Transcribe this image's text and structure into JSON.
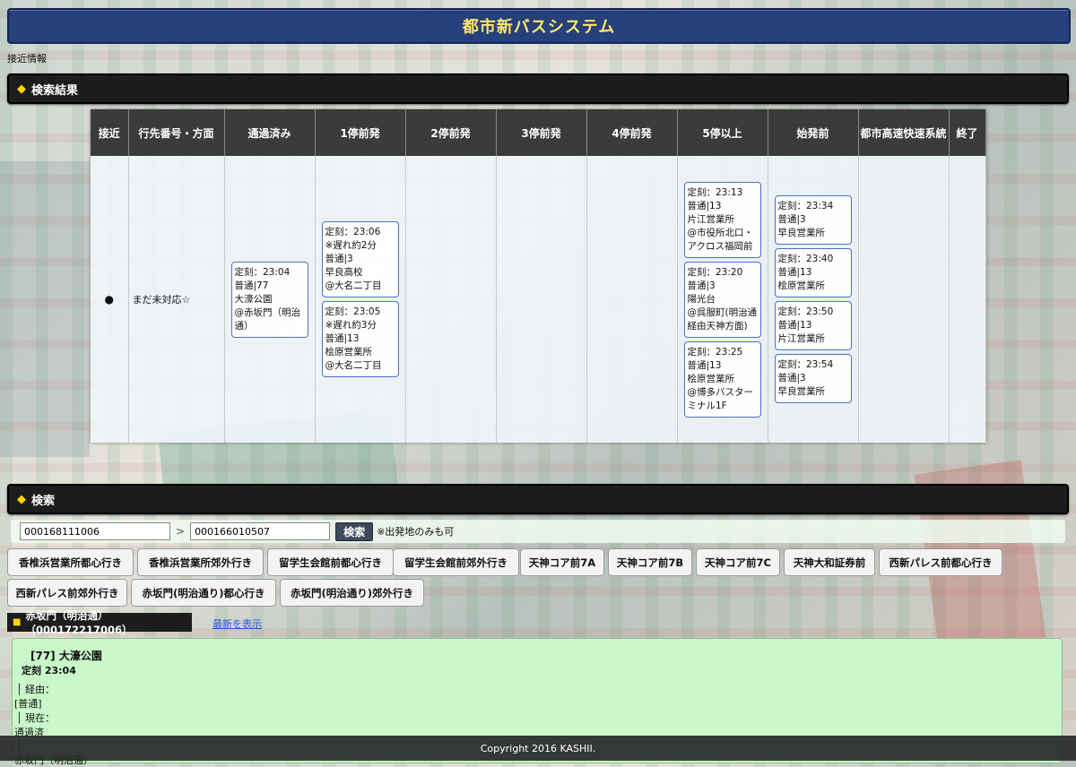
{
  "header": {
    "title": "都市新バスシステム",
    "approach_label": "接近情報"
  },
  "results_section": {
    "title": "検索結果"
  },
  "table": {
    "headers": [
      "接近",
      "行先番号・方面",
      "通過済み",
      "1停前発",
      "2停前発",
      "3停前発",
      "4停前発",
      "5停以上",
      "始発前",
      "都市高速快速系統",
      "終了"
    ],
    "approach_mark": "●",
    "destination_note": "まだ未対応☆",
    "passed": [
      {
        "lines": [
          "定刻：23:04",
          "普通|77",
          "大濠公園",
          "@赤坂門（明治通）"
        ]
      }
    ],
    "stop1": [
      {
        "lines": [
          "定刻：23:06",
          "※遅れ約2分",
          "普通|3",
          "早良高校",
          "@大名二丁目"
        ]
      },
      {
        "lines": [
          "定刻：23:05",
          "※遅れ約3分",
          "普通|13",
          "桧原営業所",
          "@大名二丁目"
        ]
      }
    ],
    "stop5plus": [
      {
        "lines": [
          "定刻：23:13",
          "普通|13",
          "片江営業所",
          "@市役所北口・アクロス福岡前"
        ]
      },
      {
        "lines": [
          "定刻：23:20",
          "普通|3",
          "陽光台",
          "@呉服町(明治通経由天神方面)"
        ]
      },
      {
        "lines": [
          "定刻：23:25",
          "普通|13",
          "桧原営業所",
          "@博多バスターミナル1F"
        ]
      }
    ],
    "before_start": [
      {
        "lines": [
          "定刻：23:34",
          "普通|3",
          "早良営業所"
        ]
      },
      {
        "lines": [
          "定刻：23:40",
          "普通|13",
          "桧原営業所"
        ]
      },
      {
        "lines": [
          "定刻：23:50",
          "普通|13",
          "片江営業所"
        ]
      },
      {
        "lines": [
          "定刻：23:54",
          "普通|3",
          "早良営業所"
        ]
      }
    ]
  },
  "search_section": {
    "title": "検索"
  },
  "search": {
    "from_value": "000168111006",
    "separator": ">",
    "to_value": "000166010507",
    "button_label": "検索",
    "note": "※出発地のみも可"
  },
  "stop_buttons": [
    "香椎浜営業所都心行き",
    "香椎浜営業所郊外行き",
    "留学生会館前都心行き",
    "留学生会館前郊外行き",
    "天神コア前7A",
    "天神コア前7B",
    "天神コア前7C",
    "天神大和証券前",
    "西新パレス前都心行き",
    "西新パレス前郊外行き",
    "赤坂門(明治通り)都心行き",
    "赤坂門(明治通り)郊外行き"
  ],
  "stop_info": {
    "name": "赤坂門（明治通）（000172217006）",
    "latest_link": "最新を表示",
    "route_title": "[77] 大濠公園",
    "time": "定刻 23:04",
    "via_label": "│ 経由：",
    "type": "[普通]",
    "current_label": "│ 現在：",
    "status": "通過済",
    "bar": "│",
    "stop_name": "赤坂門（明治通）"
  },
  "footer": {
    "text": "Copyright 2016 KASHII."
  }
}
